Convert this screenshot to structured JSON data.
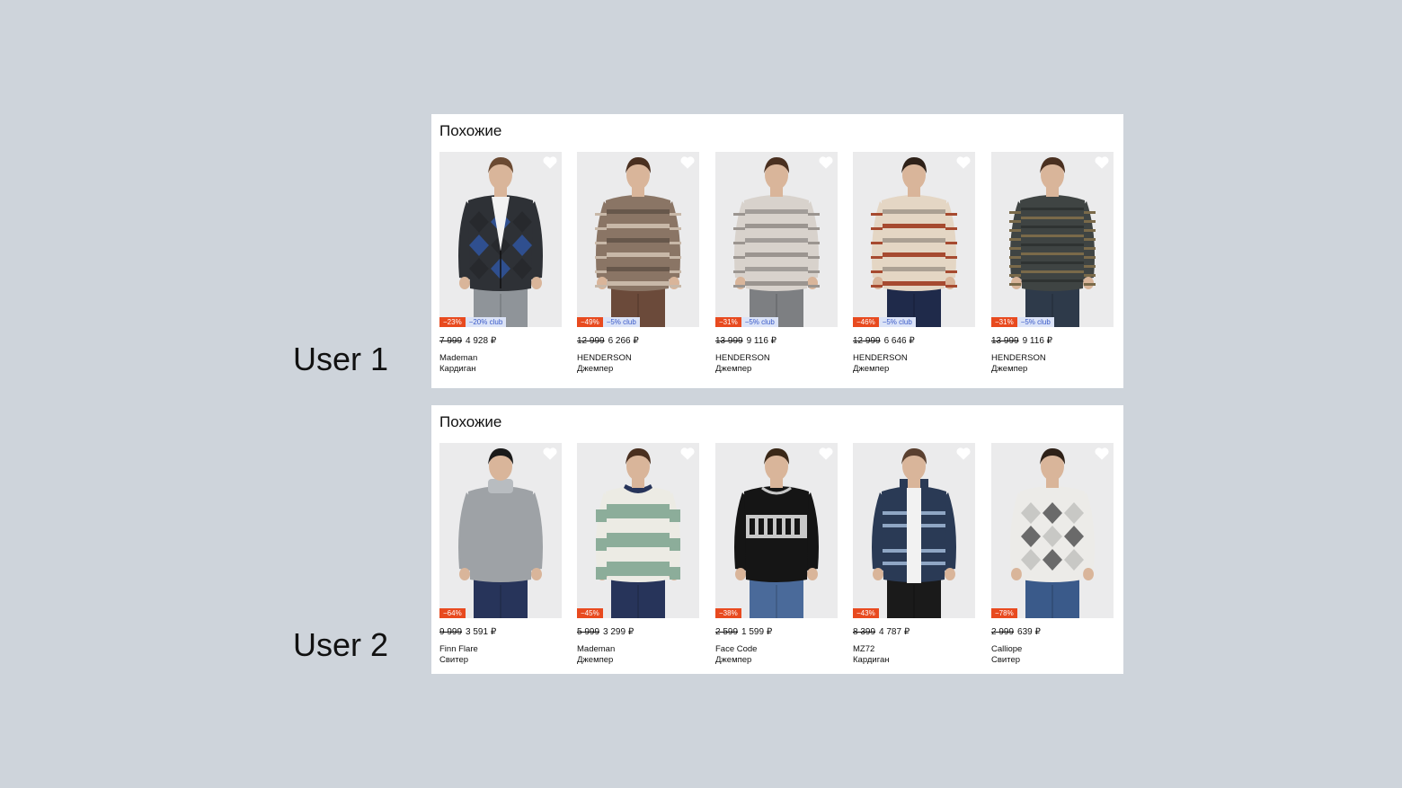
{
  "labels": {
    "user1": "User 1",
    "user2": "User 2"
  },
  "colors": {
    "background": "#ced4db",
    "discount_badge": "#e84a1f",
    "club_badge_bg": "#dbe3f7",
    "club_badge_text": "#3a5ac8"
  },
  "panels": [
    {
      "title": "Похожие",
      "products": [
        {
          "discount": "−23%",
          "club": "−20% club",
          "old_price": "7 999",
          "price": "4 928 ₽",
          "brand": "Mademan",
          "type": "Кардиган",
          "icon": "heart-icon",
          "sweater": {
            "main": "#2e3136",
            "accent": "#2f4f8f",
            "pattern": "argyle-cardigan",
            "pants": "#8f9499",
            "skin": "#d9b59a",
            "hair": "#6b4a32"
          }
        },
        {
          "discount": "−49%",
          "club": "−5% club",
          "old_price": "12 999",
          "price": "6 266 ₽",
          "brand": "HENDERSON",
          "type": "Джемпер",
          "icon": "heart-icon",
          "sweater": {
            "main": "#8a7565",
            "accent": "#c8b8a8",
            "pattern": "fair-isle",
            "pants": "#6b4a3a",
            "skin": "#d9b59a",
            "hair": "#4a3020"
          }
        },
        {
          "discount": "−31%",
          "club": "−5% club",
          "old_price": "13 999",
          "price": "9 116 ₽",
          "brand": "HENDERSON",
          "type": "Джемпер",
          "icon": "heart-icon",
          "sweater": {
            "main": "#d8d2cc",
            "accent": "#9b9590",
            "pattern": "fair-isle",
            "pants": "#7d7f82",
            "skin": "#d9b59a",
            "hair": "#4a3020"
          }
        },
        {
          "discount": "−46%",
          "club": "−5% club",
          "old_price": "12 999",
          "price": "6 646 ₽",
          "brand": "HENDERSON",
          "type": "Джемпер",
          "icon": "heart-icon",
          "sweater": {
            "main": "#e4d6c4",
            "accent": "#a64a30",
            "pattern": "fair-isle",
            "pants": "#1f2a4a",
            "skin": "#d9b59a",
            "hair": "#2e2118"
          }
        },
        {
          "discount": "−31%",
          "club": "−5% club",
          "old_price": "13 999",
          "price": "9 116 ₽",
          "brand": "HENDERSON",
          "type": "Джемпер",
          "icon": "heart-icon",
          "sweater": {
            "main": "#3f4443",
            "accent": "#7a6a4a",
            "pattern": "stripes",
            "pants": "#2e3a4a",
            "skin": "#d9b59a",
            "hair": "#4a3020"
          }
        }
      ]
    },
    {
      "title": "Похожие",
      "products": [
        {
          "discount": "−64%",
          "club": "",
          "old_price": "9 999",
          "price": "3 591 ₽",
          "brand": "Finn Flare",
          "type": "Свитер",
          "icon": "heart-icon",
          "sweater": {
            "main": "#9ea2a6",
            "accent": "#b8bcc0",
            "pattern": "turtleneck",
            "pants": "#27345a",
            "skin": "#d9b59a",
            "hair": "#1a1a1a"
          }
        },
        {
          "discount": "−45%",
          "club": "",
          "old_price": "5 999",
          "price": "3 299 ₽",
          "brand": "Mademan",
          "type": "Джемпер",
          "icon": "heart-icon",
          "sweater": {
            "main": "#ecebe4",
            "accent": "#8cad9a",
            "pattern": "wide-stripes",
            "pants": "#27345a",
            "skin": "#d9b59a",
            "hair": "#4a3020"
          }
        },
        {
          "discount": "−38%",
          "club": "",
          "old_price": "2 599",
          "price": "1 599 ₽",
          "brand": "Face Code",
          "type": "Джемпер",
          "icon": "heart-icon",
          "sweater": {
            "main": "#151515",
            "accent": "#c8c8c8",
            "pattern": "letters",
            "pants": "#4a6a9a",
            "skin": "#d9b59a",
            "hair": "#3a2818"
          }
        },
        {
          "discount": "−43%",
          "club": "",
          "old_price": "8 399",
          "price": "4 787 ₽",
          "brand": "MZ72",
          "type": "Кардиган",
          "icon": "heart-icon",
          "sweater": {
            "main": "#2a3a55",
            "accent": "#8fa6c4",
            "pattern": "zip-cardigan",
            "pants": "#1a1a1a",
            "skin": "#d9b59a",
            "hair": "#5a4030"
          }
        },
        {
          "discount": "−78%",
          "club": "",
          "old_price": "2 999",
          "price": "639 ₽",
          "brand": "Calliope",
          "type": "Свитер",
          "icon": "heart-icon",
          "sweater": {
            "main": "#ecebe8",
            "accent": "#6a6a6a",
            "pattern": "argyle",
            "pants": "#3a5a8a",
            "skin": "#d9b59a",
            "hair": "#2e2118"
          }
        }
      ]
    }
  ]
}
